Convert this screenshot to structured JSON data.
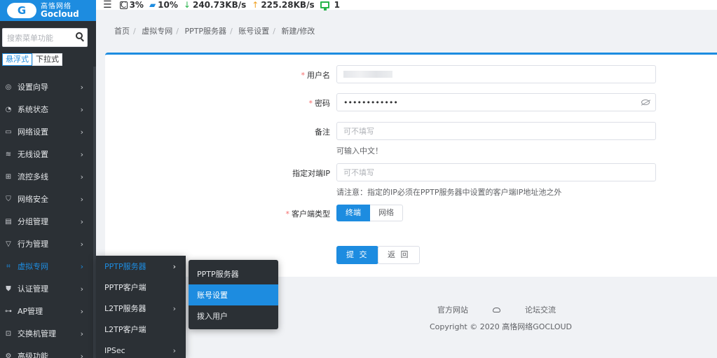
{
  "logo": {
    "mark": "G",
    "cn": "高恪网络",
    "en": "Gocloud"
  },
  "topbar": {
    "cpu_label": "C",
    "cpu": "3%",
    "mem": "10%",
    "down": "240.73KB/s",
    "up": "225.28KB/s",
    "clients": "1"
  },
  "sidebar": {
    "search_placeholder": "搜索菜单功能",
    "mode_float": "悬浮式",
    "mode_dropdown": "下拉式",
    "items": [
      {
        "label": "设置向导",
        "icon": "compass-icon"
      },
      {
        "label": "系统状态",
        "icon": "dashboard-icon"
      },
      {
        "label": "网络设置",
        "icon": "monitor-icon"
      },
      {
        "label": "无线设置",
        "icon": "wifi-icon"
      },
      {
        "label": "流控多线",
        "icon": "network-icon"
      },
      {
        "label": "网络安全",
        "icon": "shield-icon"
      },
      {
        "label": "分组管理",
        "icon": "document-icon"
      },
      {
        "label": "行为管理",
        "icon": "funnel-icon"
      },
      {
        "label": "虚拟专网",
        "icon": "vpn-icon"
      },
      {
        "label": "认证管理",
        "icon": "check-shield-icon"
      },
      {
        "label": "AP管理",
        "icon": "sitemap-icon"
      },
      {
        "label": "交换机管理",
        "icon": "switch-icon"
      },
      {
        "label": "高级功能",
        "icon": "gear-icon"
      }
    ]
  },
  "submenu1": [
    {
      "label": "PPTP服务器",
      "has_children": true
    },
    {
      "label": "PPTP客户端",
      "has_children": false
    },
    {
      "label": "L2TP服务器",
      "has_children": true
    },
    {
      "label": "L2TP客户端",
      "has_children": false
    },
    {
      "label": "IPSec",
      "has_children": true
    }
  ],
  "submenu2": [
    {
      "label": "PPTP服务器"
    },
    {
      "label": "账号设置"
    },
    {
      "label": "拨入用户"
    }
  ],
  "breadcrumb": [
    "首页",
    "虚拟专网",
    "PPTP服务器",
    "账号设置",
    "新建/修改"
  ],
  "form": {
    "username": {
      "label": "用户名",
      "required": true
    },
    "password": {
      "label": "密码",
      "required": true,
      "value": "••••••••••••"
    },
    "remark": {
      "label": "备注",
      "placeholder": "可不填写",
      "hint": "可输入中文！"
    },
    "peer_ip": {
      "label": "指定对端IP",
      "placeholder": "可不填写",
      "hint": "请注意：指定的IP必须在PPTP服务器中设置的客户端IP地址池之外"
    },
    "client_type": {
      "label": "客户端类型",
      "required": true,
      "options": [
        "终端",
        "网络"
      ],
      "selected": "终端"
    },
    "submit": "提 交",
    "back": "返 回"
  },
  "footer": {
    "link_official": "官方网站",
    "link_forum": "论坛交流",
    "copyright": "Copyright © 2020 高恪网络GOCLOUD"
  },
  "colors": {
    "accent": "#1d8ce0",
    "sidebar_bg": "#2b3035",
    "required": "#f56c6c"
  }
}
